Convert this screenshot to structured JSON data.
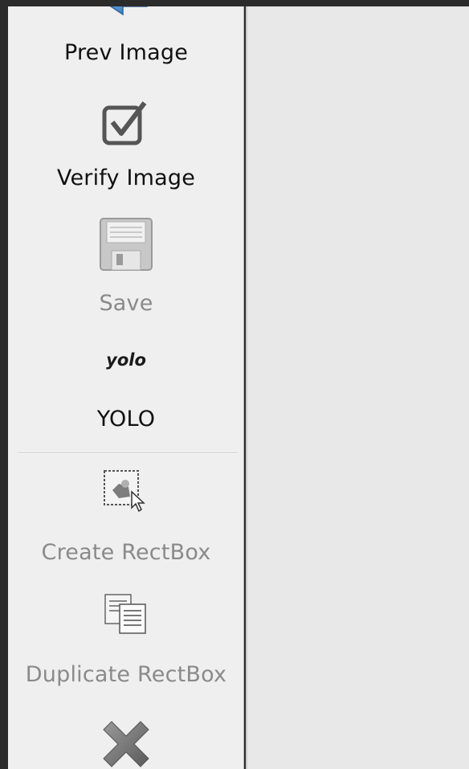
{
  "toolbar": {
    "items": [
      {
        "label": "Prev Image",
        "icon": "arrow-left-icon",
        "enabled": true
      },
      {
        "label": "Verify Image",
        "icon": "checkbox-icon",
        "enabled": true
      },
      {
        "label": "Save",
        "icon": "floppy-disk-icon",
        "enabled": false
      },
      {
        "label": "YOLO",
        "icon_text": "yolo",
        "icon": "yolo-format-icon",
        "enabled": true
      },
      {
        "label": "Create RectBox",
        "icon": "create-rectbox-icon",
        "enabled": false
      },
      {
        "label": "Duplicate RectBox",
        "icon": "duplicate-rectbox-icon",
        "enabled": false
      },
      {
        "label": "",
        "icon": "delete-x-icon",
        "enabled": false
      }
    ]
  },
  "colors": {
    "frame": "#2b2b2b",
    "toolbar_bg": "#efefef",
    "canvas_bg": "#e8e8e8",
    "accent_blue": "#4f8fd1",
    "disabled_text": "#8a8a8a"
  }
}
